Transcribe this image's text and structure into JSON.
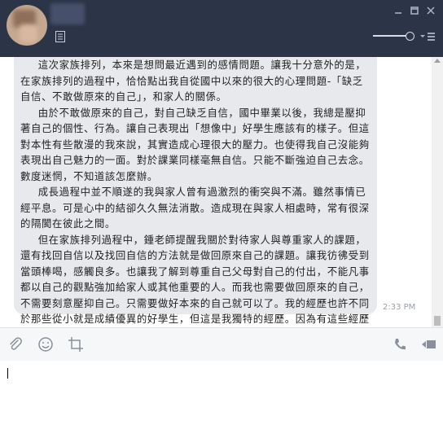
{
  "header": {
    "contact_name": "",
    "buttons": [
      "minimize-icon",
      "maximize-icon",
      "close-icon"
    ],
    "volume_level": 0.9
  },
  "message": {
    "paragraphs": [
      "這次家族排列，本來是想問最近遇到的感情問題。讓我十分意外的是，在家族排列的過程中，恰恰點出我自從國中以來的很大的心理問題-「缺乏自信、不敢做原來的自己」，和家人的關係。",
      "由於不敢做原來的自己，對自己缺乏自信，國中畢業以後，我總是壓抑著自己的個性、行為。讓自己表現出「想像中」好學生應該有的樣子。但這對本性有些散漫的我來說，其實造成心理很大的壓力。也使得我自己沒能夠表現出自己魅力的一面。對於課業同樣毫無自信。只能不斷強迫自己去念。數度迷惘，不知道該怎麼辦。",
      "成長過程中並不順遂的我與家人曾有過激烈的衝突與不滿。雖然事情已經平息。可是心中的結卻久久無法消散。造成現在與家人相處時，常有很深的隔閡在彼此之間。",
      "但在家族排列過程中，鍾老師提醒我關於對待家人與尊重家人的課題，還有找回自信以及找回自信的方法就是做回原來自己的課題。讓我彷彿受到當頭棒喝，感觸良多。也讓我了解到尊重自己父母對自己的付出，不能凡事都以自己的觀點強加給家人或其他重要的人。而我也需要做回原來的自己，不需要刻意壓抑自己。只需要做好本來的自己就可以了。我的經歷也許不同於那些從小就是成績優異的好學生，但這是我獨特的經歷。因為有這些經歷讓我有不同的視野等等。這些都是值得我自己欣賞與面對的事情。"
    ],
    "timestamp": "2:33 PM"
  },
  "toolbar": {
    "left_icons": [
      "attachment-icon",
      "emoji-icon",
      "crop-icon"
    ],
    "right_icons": [
      "phone-icon",
      "video-icon"
    ]
  },
  "input": {
    "value": ""
  }
}
